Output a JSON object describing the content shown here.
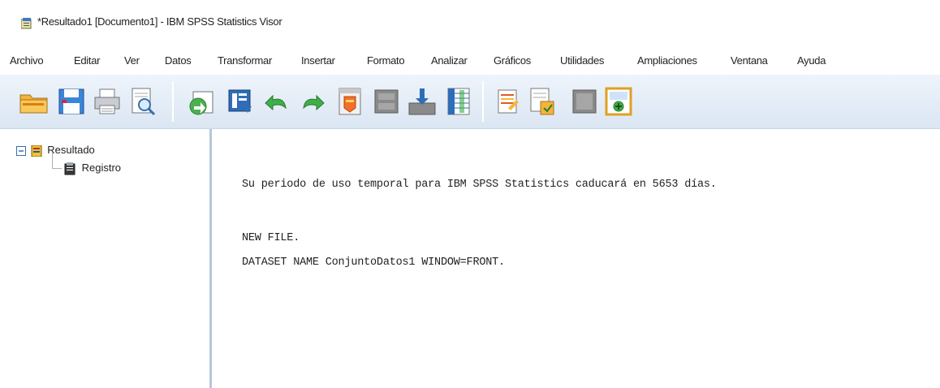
{
  "window": {
    "title": "*Resultado1 [Documento1] - IBM SPSS Statistics Visor"
  },
  "menu": {
    "items": [
      "Archivo",
      "Editar",
      "Ver",
      "Datos",
      "Transformar",
      "Insertar",
      "Formato",
      "Analizar",
      "Gráficos",
      "Utilidades",
      "Ampliaciones",
      "Ventana",
      "Ayuda"
    ]
  },
  "toolbar": {
    "icons": [
      "open-folder-icon",
      "save-icon",
      "print-icon",
      "print-preview-icon",
      "export-icon",
      "recall-dialog-icon",
      "undo-icon",
      "redo-icon",
      "goto-data-icon",
      "goto-case-icon",
      "goto-variable-icon",
      "variables-icon",
      "select-output-icon",
      "designate-window-icon",
      "show-all-icon",
      "insert-heading-icon"
    ]
  },
  "outline": {
    "root_label": "Resultado",
    "child_label": "Registro"
  },
  "log": {
    "line1": "Su periodo de uso temporal para IBM SPSS Statistics caducará en 5653 días.",
    "line2": "NEW FILE.",
    "line3": "DATASET NAME ConjuntoDatos1 WINDOW=FRONT."
  }
}
